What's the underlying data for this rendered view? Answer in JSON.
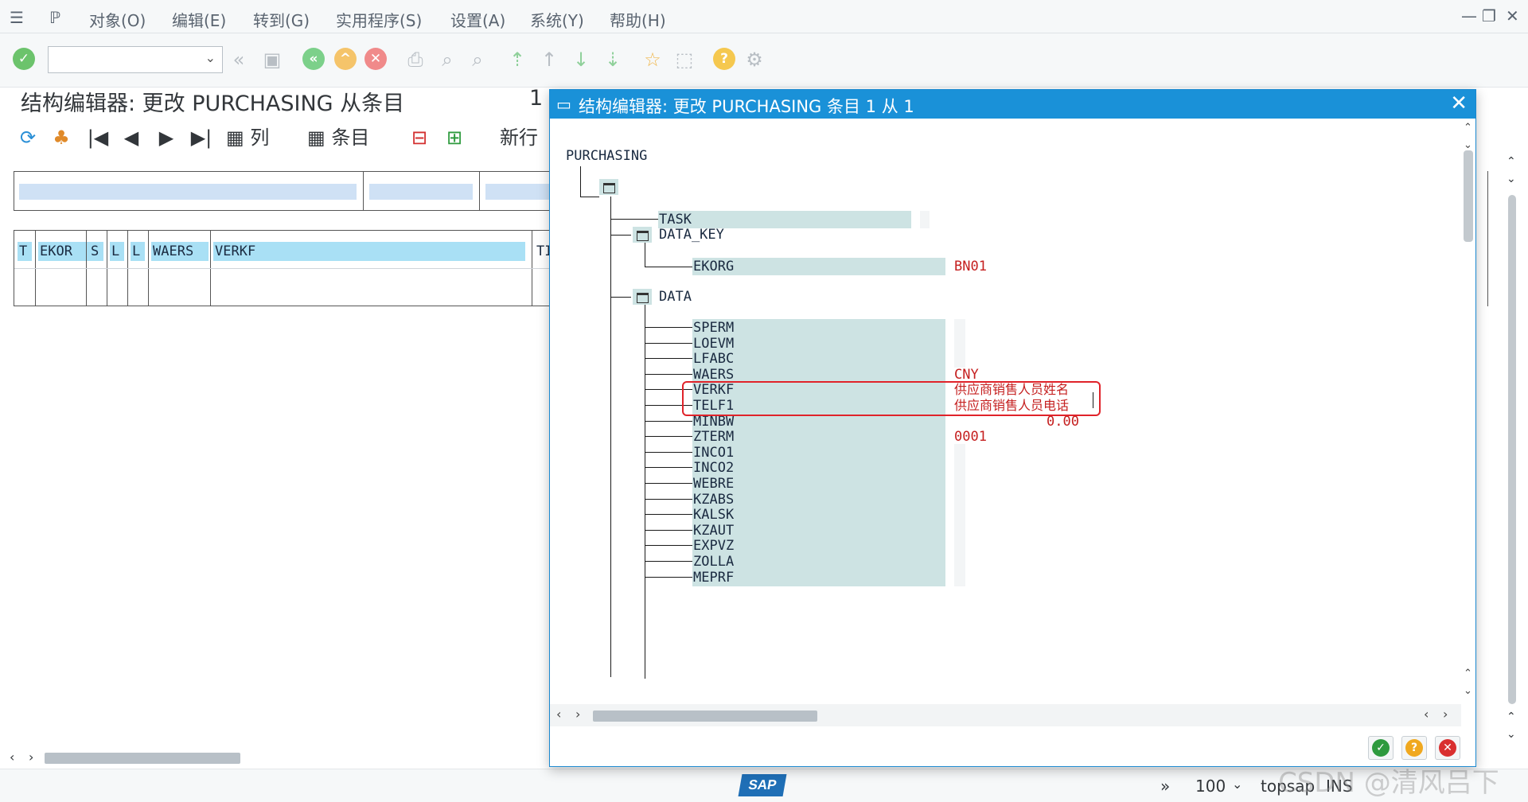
{
  "menu": {
    "items": [
      "对象(O)",
      "编辑(E)",
      "转到(G)",
      "实用程序(S)",
      "设置(A)",
      "系统(Y)",
      "帮助(H)"
    ]
  },
  "toolbar": {
    "command_field_value": "",
    "icons": [
      "enter-icon",
      "back-icon",
      "save-icon",
      "back-nav-icon",
      "exit-icon",
      "cancel-icon",
      "print-icon",
      "find-icon",
      "find-next-icon",
      "first-page-icon",
      "prev-page-icon",
      "next-page-icon",
      "last-page-icon",
      "new-session-icon",
      "shortcut-icon",
      "help-icon",
      "settings-icon"
    ]
  },
  "screen": {
    "title": "结构编辑器: 更改 PURCHASING 从条目",
    "entry_number": "1",
    "app_toolbar": {
      "column_label": "列",
      "entry_label": "条目",
      "new_row_label": "新行"
    },
    "grid_headers": [
      "T",
      "EKOR",
      "S",
      "L",
      "L",
      "WAERS",
      "VERKF",
      "TI"
    ]
  },
  "dialog": {
    "title": "结构编辑器: 更改 PURCHASING 条目 1 从 1",
    "root": "PURCHASING",
    "nodes": {
      "task": "TASK",
      "data_key": "DATA_KEY",
      "ekorg": "EKORG",
      "ekorg_value": "BN01",
      "data": "DATA"
    },
    "fields": [
      {
        "name": "SPERM",
        "value": ""
      },
      {
        "name": "LOEVM",
        "value": ""
      },
      {
        "name": "LFABC",
        "value": ""
      },
      {
        "name": "WAERS",
        "value": "CNY"
      },
      {
        "name": "VERKF",
        "value": "供应商销售人员姓名"
      },
      {
        "name": "TELF1",
        "value": "供应商销售人员电话"
      },
      {
        "name": "MINBW",
        "value": "0.00"
      },
      {
        "name": "ZTERM",
        "value": "0001"
      },
      {
        "name": "INCO1",
        "value": ""
      },
      {
        "name": "INCO2",
        "value": ""
      },
      {
        "name": "WEBRE",
        "value": ""
      },
      {
        "name": "KZABS",
        "value": ""
      },
      {
        "name": "KALSK",
        "value": ""
      },
      {
        "name": "KZAUT",
        "value": ""
      },
      {
        "name": "EXPVZ",
        "value": ""
      },
      {
        "name": "ZOLLA",
        "value": ""
      },
      {
        "name": "MEPRF",
        "value": ""
      }
    ],
    "buttons": [
      "confirm-icon",
      "help-icon",
      "cancel-icon"
    ]
  },
  "statusbar": {
    "zoom": "100",
    "system": "topsap",
    "mode": "INS"
  },
  "watermark": "CSDN @清风吕下",
  "colors": {
    "title_blue": "#1a91d8",
    "field_bg": "#cde3e3",
    "value_red": "#c52020",
    "highlight_red": "#e0232a",
    "grid_header": "#a9e0f5"
  }
}
